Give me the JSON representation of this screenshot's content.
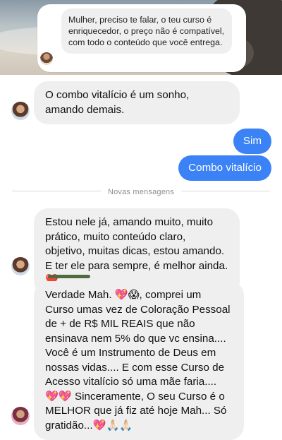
{
  "reply": {
    "text": "Mulher, preciso te falar, o teu curso é enriquecedor, o preço não é compatível, com todo o conteúdo que você entrega."
  },
  "messages": [
    {
      "direction": "incoming",
      "text": "O combo vitalício é um sonho, amando demais."
    },
    {
      "direction": "outgoing",
      "text": "Sim"
    },
    {
      "direction": "outgoing",
      "text": "Combo vitalício"
    },
    {
      "direction": "incoming",
      "text": "Estou nele já, amando muito, muito prático, muito conteúdo claro, objetivo, muitas dicas, estou amando. E ter ele para sempre, é melhor ainda. ❤️"
    },
    {
      "direction": "incoming",
      "text": "Verdade Mah. 💖😱, comprei um Curso umas vez de Coloração Pessoal de + de R$ MIL REAIS que não ensinava nem 5% do que vc ensina.... Você é um Instrumento de Deus em nossas vidas.... E com esse Curso de Acesso vitalício só uma mãe faria.... 💖💖 Sinceramente, O seu Curso é o MELHOR que já fiz até hoje Mah... Só gratidão...💖🙏🏻🙏🏻"
    }
  ],
  "divider": {
    "label": "Novas mensagens"
  },
  "colors": {
    "outgoing_bubble": "#3a82f6",
    "incoming_bubble": "#efefef"
  },
  "icons": {
    "avatar": "contact-avatar-icon"
  }
}
